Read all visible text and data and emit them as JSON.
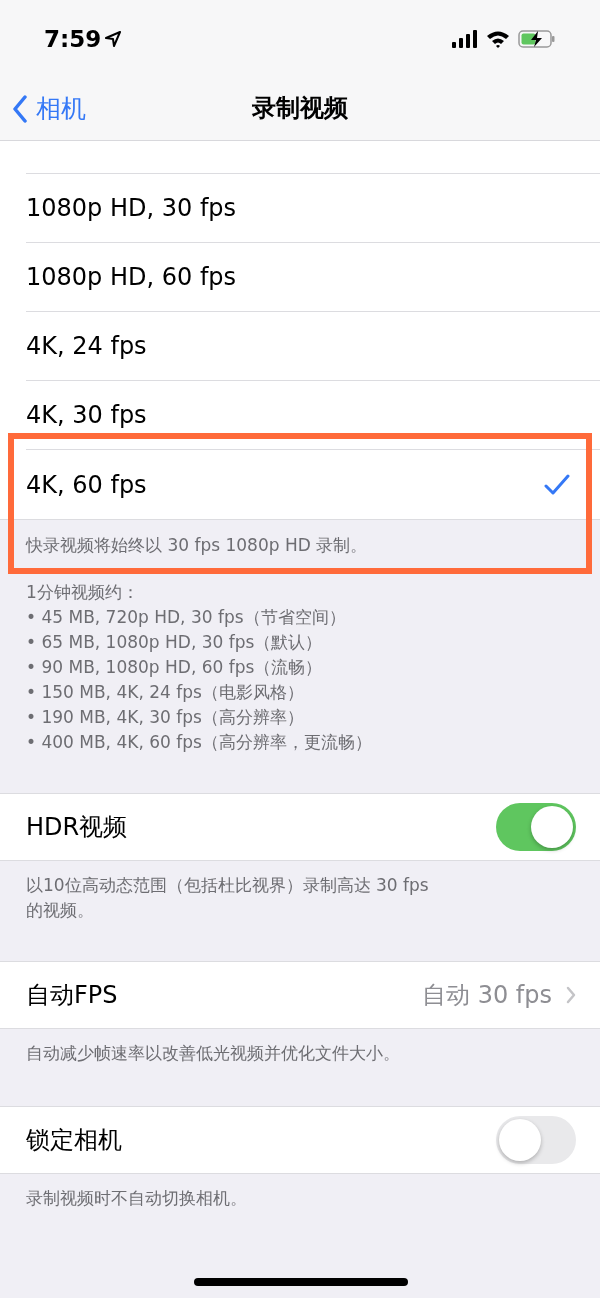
{
  "status_bar": {
    "time": "7:59"
  },
  "nav": {
    "back": "相机",
    "title": "录制视频"
  },
  "options": [
    {
      "label": "1080p HD, 30 fps",
      "checked": false
    },
    {
      "label": "1080p HD, 60 fps",
      "checked": false
    },
    {
      "label": "4K, 24 fps",
      "checked": false
    },
    {
      "label": "4K, 30 fps",
      "checked": false
    },
    {
      "label": "4K, 60 fps",
      "checked": true
    }
  ],
  "last_option_highlighted": true,
  "options_note": "快录视频将始终以 30 fps 1080p HD 录制。",
  "size_info": {
    "heading": "1分钟视频约：",
    "items": [
      "• 45 MB, 720p HD, 30 fps（节省空间）",
      "• 65 MB, 1080p HD, 30 fps（默认）",
      "• 90 MB, 1080p HD, 60 fps（流畅）",
      "• 150 MB, 4K, 24 fps（电影风格）",
      "• 190 MB, 4K, 30 fps（高分辨率）",
      "• 400 MB, 4K, 60 fps（高分辨率，更流畅）"
    ]
  },
  "settings": [
    {
      "kind": "toggle",
      "label": "HDR视频",
      "on": true,
      "footer": "以10位高动态范围（包括杜比视界）录制高达 30 fps\n的视频。"
    },
    {
      "kind": "link",
      "label": "自动FPS",
      "value": "自动 30 fps",
      "footer": "自动减少帧速率以改善低光视频并优化文件大小。"
    },
    {
      "kind": "toggle",
      "label": "锁定相机",
      "on": false,
      "footer": "录制视频时不自动切换相机。"
    }
  ]
}
